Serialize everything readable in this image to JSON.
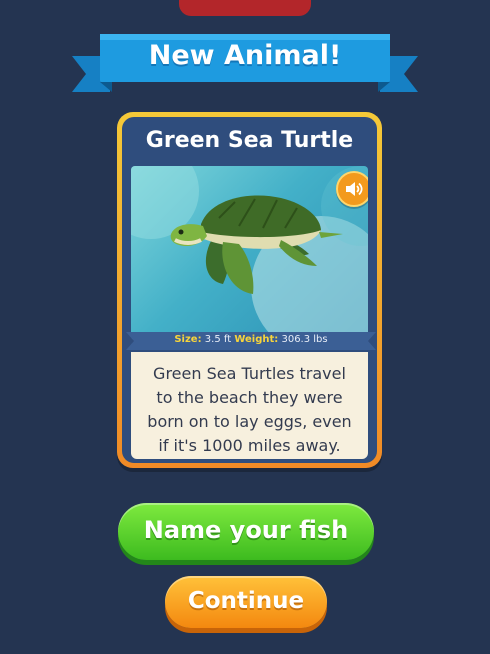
{
  "banner": {
    "title": "New Animal!"
  },
  "card": {
    "name": "Green Sea Turtle",
    "sound_icon": "speaker-icon",
    "stats": {
      "size_label": "Size:",
      "size_value": "3.5 ft",
      "weight_label": "Weight:",
      "weight_value": "306.3 lbs"
    },
    "fact_line_1": "Green Sea Turtles travel",
    "fact_line_2": "to the beach they were",
    "fact_line_3": "born on to lay eggs, even",
    "fact_line_4": "if it's 1000 miles away."
  },
  "buttons": {
    "name_fish": "Name your fish",
    "continue": "Continue"
  },
  "colors": {
    "background": "#243451",
    "card_border": "#f5c938",
    "banner": "#1e9be0",
    "name_button": "#3dbb1f",
    "continue_button": "#f4880f"
  }
}
